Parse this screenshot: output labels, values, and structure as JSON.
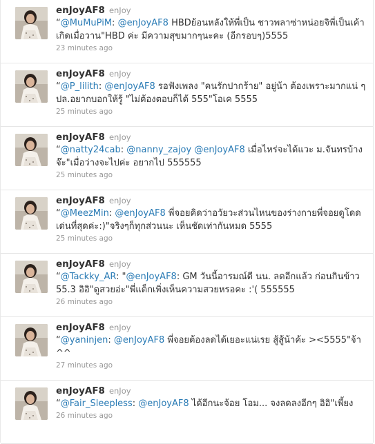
{
  "tweets": [
    {
      "screen_name": "enJoyAF8",
      "full_name": "enJoy",
      "parts": [
        {
          "t": "“",
          "m": false
        },
        {
          "t": "@MuMuPiM",
          "m": true
        },
        {
          "t": ": ",
          "m": false
        },
        {
          "t": "@enJoyAF8",
          "m": true
        },
        {
          "t": " HBDย้อนหลังให้พี่เป็น ชาวพลาซ่าหน่อยจิพี่เป็นเค้าเกิดเมื่อวาน\"HBD ค่ะ มีความสุขมากๆนะคะ (อีกรอบๆ)5555",
          "m": false
        }
      ],
      "time": "23 minutes ago"
    },
    {
      "screen_name": "enJoyAF8",
      "full_name": "enJoy",
      "parts": [
        {
          "t": "“",
          "m": false
        },
        {
          "t": "@P_lilith",
          "m": true
        },
        {
          "t": ": ",
          "m": false
        },
        {
          "t": "@enJoyAF8",
          "m": true
        },
        {
          "t": " รอฟังเพลง \"คนรักปากร้าย\" อยู่น้า ต้องเพราะมากแน่ ๆ ปล.อยากบอกให้รู้ \"ไม่ต้องตอบก็ได้ 555\"โอเค 5555",
          "m": false
        }
      ],
      "time": "25 minutes ago"
    },
    {
      "screen_name": "enJoyAF8",
      "full_name": "enJoy",
      "parts": [
        {
          "t": "“",
          "m": false
        },
        {
          "t": "@natty24cab",
          "m": true
        },
        {
          "t": ": ",
          "m": false
        },
        {
          "t": "@nanny_zajoy",
          "m": true
        },
        {
          "t": " ",
          "m": false
        },
        {
          "t": "@enJoyAF8",
          "m": true
        },
        {
          "t": " เมื่อไหร่จะได้แวะ ม.จันทรบ้างจ๊ะ\"เมื่อว่างจะไปค่ะ อยากไป 555555",
          "m": false
        }
      ],
      "time": "25 minutes ago"
    },
    {
      "screen_name": "enJoyAF8",
      "full_name": "enJoy",
      "parts": [
        {
          "t": "“",
          "m": false
        },
        {
          "t": "@MeezMin",
          "m": true
        },
        {
          "t": ": ",
          "m": false
        },
        {
          "t": "@enJoyAF8",
          "m": true
        },
        {
          "t": " พี่จอยคิดว่าอวัยวะส่วนไหนของร่างกายพี่จอยดูโดดเด่นที่สุดค่ะ:)\"จริงๆก็ทุกส่วนนะ เห็นชัดเท่ากันหมด 5555",
          "m": false
        }
      ],
      "time": "25 minutes ago"
    },
    {
      "screen_name": "enJoyAF8",
      "full_name": "enJoy",
      "parts": [
        {
          "t": "“",
          "m": false
        },
        {
          "t": "@Tackky_AR",
          "m": true
        },
        {
          "t": ": \"",
          "m": false
        },
        {
          "t": "@enJoyAF8",
          "m": true
        },
        {
          "t": ": GM วันนี้อารมณ์ดี นน. ลดอีกแล้ว ก่อนกินข้าว 55.3 อิอิ\"ดูสวยอ่ะ\"พี่แต็กเพิ่งเห็นความสวยหรอคะ :'( 555555",
          "m": false
        }
      ],
      "time": "26 minutes ago"
    },
    {
      "screen_name": "enJoyAF8",
      "full_name": "enJoy",
      "parts": [
        {
          "t": "“",
          "m": false
        },
        {
          "t": "@yaninjen",
          "m": true
        },
        {
          "t": ": ",
          "m": false
        },
        {
          "t": "@enJoyAF8",
          "m": true
        },
        {
          "t": " พี่จอยต้องลดได้เยอะแน่เรย สู้สู้น้าค้ะ ><5555\"จ้า ^^",
          "m": false
        }
      ],
      "time": "27 minutes ago"
    },
    {
      "screen_name": "enJoyAF8",
      "full_name": "enJoy",
      "parts": [
        {
          "t": "“",
          "m": false
        },
        {
          "t": "@Fair_Sleepless",
          "m": true
        },
        {
          "t": ": ",
          "m": false
        },
        {
          "t": "@enJoyAF8",
          "m": true
        },
        {
          "t": " ได้อีกนะจ้อย โอม... จงลดลงอีกๆ อิอิ\"เพี้ยง",
          "m": false
        }
      ],
      "time": "26 minutes ago"
    }
  ]
}
